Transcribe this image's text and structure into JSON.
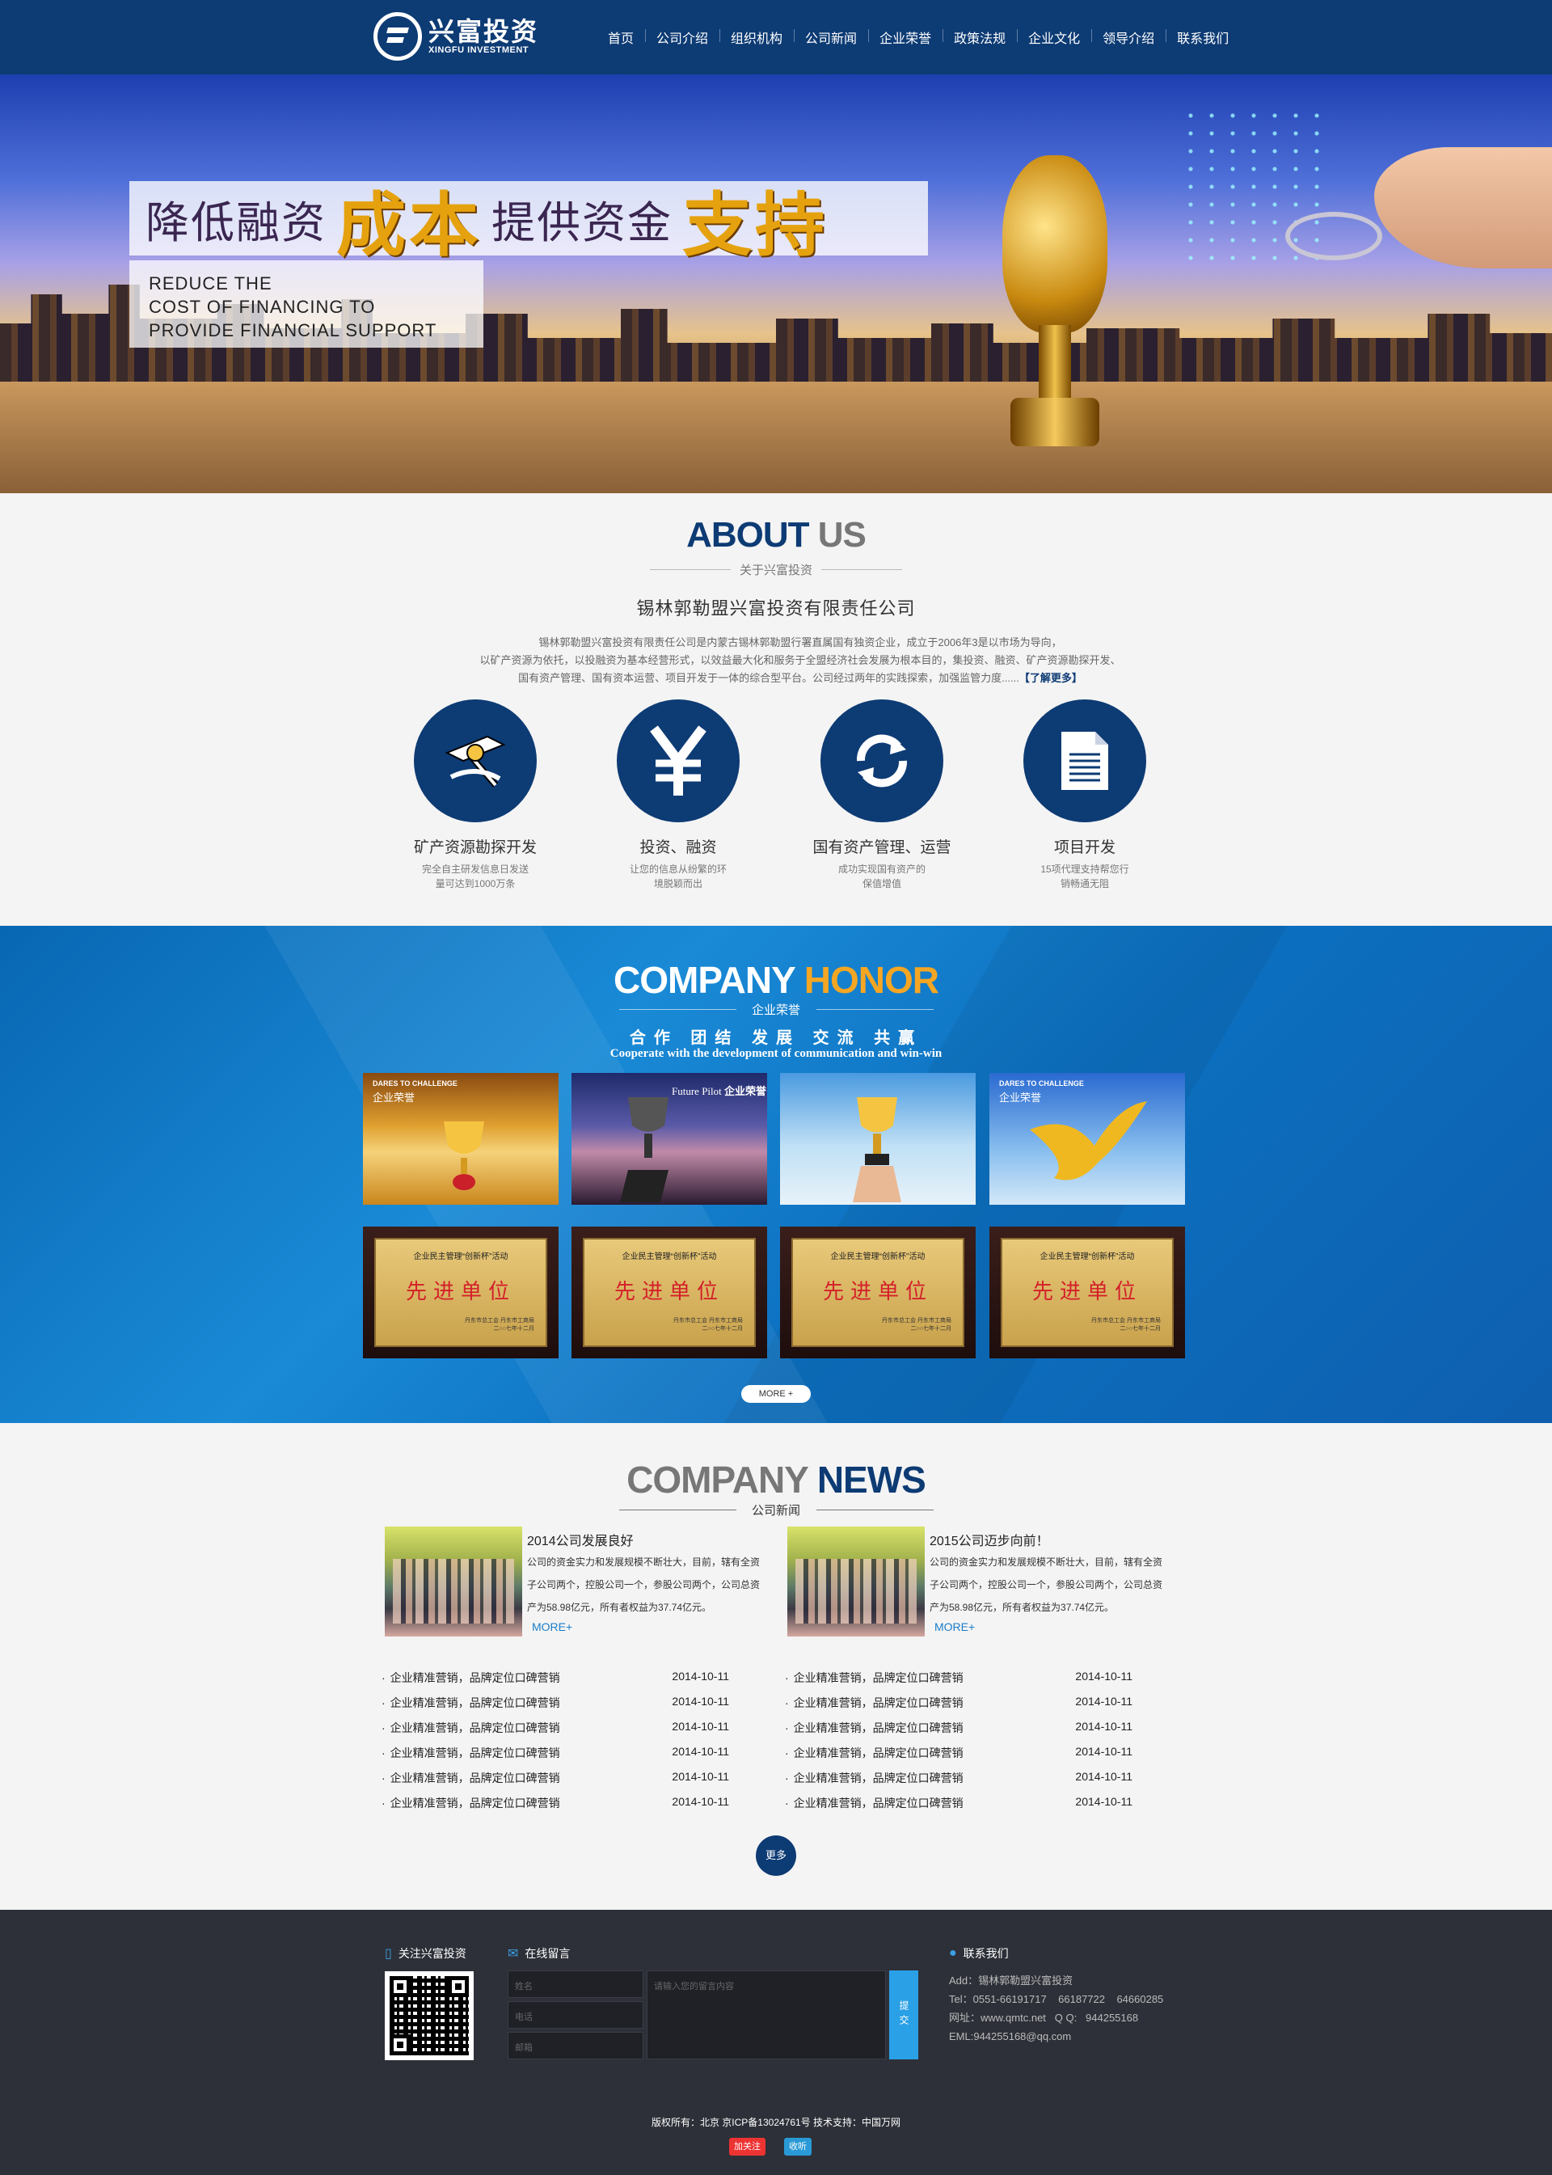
{
  "header": {
    "logo_cn": "兴富投资",
    "logo_en": "XINGFU INVESTMENT",
    "nav": [
      "首页",
      "公司介绍",
      "组织机构",
      "公司新闻",
      "企业荣誉",
      "政策法规",
      "企业文化",
      "领导介绍",
      "联系我们"
    ]
  },
  "banner": {
    "line1_part1": "降低融资",
    "line1_part2": "成本",
    "line1_part3": "提供资金",
    "line1_part4": "支持",
    "en_line1": "REDUCE THE",
    "en_line2": "COST OF FINANCING TO",
    "en_line3": "PROVIDE FINANCIAL SUPPORT"
  },
  "about": {
    "title_a": "ABOUT",
    "title_b": "US",
    "subtitle": "关于兴富投资",
    "company": "锡林郭勒盟兴富投资有限责任公司",
    "desc_line1": "锡林郭勒盟兴富投资有限责任公司是内蒙古锡林郭勒盟行署直属国有独资企业，成立于2006年3是以市场为导向，",
    "desc_line2": "以矿产资源为依托，以投融资为基本经营形式，以效益最大化和服务于全盟经济社会发展为根本目的，集投资、融资、矿产资源勘探开发、",
    "desc_line3": "国有资产管理、国有资本运营、项目开发于一体的综合型平台。公司经过两年的实践探索，加强监管力度......",
    "more": "【了解更多】",
    "services": [
      {
        "name": "矿产资源勘探开发",
        "desc1": "完全自主研发信息日发送",
        "desc2": "量可达到1000万条",
        "icon": "mining-icon"
      },
      {
        "name": "投资、融资",
        "desc1": "让您的信息从纷繁的环",
        "desc2": "境脱颖而出",
        "icon": "yen-icon"
      },
      {
        "name": "国有资产管理、运营",
        "desc1": "成功实现国有资产的",
        "desc2": "保值增值",
        "icon": "refresh-icon"
      },
      {
        "name": "项目开发",
        "desc1": "15项代理支持帮您行",
        "desc2": "销畅通无阻",
        "icon": "document-icon"
      }
    ]
  },
  "honor": {
    "title_a": "COMPANY",
    "title_b": "HONOR",
    "subtitle": "企业荣誉",
    "slogan": "合作 团结 发展 交流 共赢",
    "slogan_en": "Cooperate with the development of communication and win-win",
    "photos": [
      {
        "tag": "DARES TO CHALLENGE",
        "label": "企业荣誉"
      },
      {
        "tag": "Future Pilot",
        "label": "企业荣誉"
      },
      {
        "tag": "",
        "label": ""
      },
      {
        "tag": "DARES TO CHALLENGE",
        "label": "企业荣誉"
      }
    ],
    "plaque_top": "企业民主管理“创新杯”活动",
    "plaque_main": "先进单位",
    "plaque_org": "丹东市总工会 丹东市工商局",
    "plaque_date": "二○○七年十二月",
    "more": "MORE +"
  },
  "news": {
    "title_a": "COMPANY",
    "title_b": "NEWS",
    "subtitle": "公司新闻",
    "featured": [
      {
        "title": "2014公司发展良好",
        "text": "公司的资金实力和发展规模不断壮大，目前，辖有全资子公司两个，控股公司一个，参股公司两个，公司总资产为58.98亿元，所有者权益为37.74亿元。",
        "more": "MORE+"
      },
      {
        "title": "2015公司迈步向前！",
        "text": "公司的资金实力和发展规模不断壮大，目前，辖有全资子公司两个，控股公司一个，参股公司两个，公司总资产为58.98亿元，所有者权益为37.74亿元。",
        "more": "MORE+"
      }
    ],
    "list_left": [
      {
        "title": "企业精准营销，品牌定位口碑营销",
        "date": "2014-10-11"
      },
      {
        "title": "企业精准营销，品牌定位口碑营销",
        "date": "2014-10-11"
      },
      {
        "title": "企业精准营销，品牌定位口碑营销",
        "date": "2014-10-11"
      },
      {
        "title": "企业精准营销，品牌定位口碑营销",
        "date": "2014-10-11"
      },
      {
        "title": "企业精准营销，品牌定位口碑营销",
        "date": "2014-10-11"
      },
      {
        "title": "企业精准营销，品牌定位口碑营销",
        "date": "2014-10-11"
      }
    ],
    "list_right": [
      {
        "title": "企业精准营销，品牌定位口碑营销",
        "date": "2014-10-11"
      },
      {
        "title": "企业精准营销，品牌定位口碑营销",
        "date": "2014-10-11"
      },
      {
        "title": "企业精准营销，品牌定位口碑营销",
        "date": "2014-10-11"
      },
      {
        "title": "企业精准营销，品牌定位口碑营销",
        "date": "2014-10-11"
      },
      {
        "title": "企业精准营销，品牌定位口碑营销",
        "date": "2014-10-11"
      },
      {
        "title": "企业精准营销，品牌定位口碑营销",
        "date": "2014-10-11"
      }
    ],
    "more": "更多"
  },
  "footer": {
    "follow": "关注兴富投资",
    "message": "在线留言",
    "name_ph": "姓名",
    "phone_ph": "电话",
    "email_ph": "邮箱",
    "content_ph": "请输入您的留言内容",
    "submit": "提交",
    "contact_title": "联系我们",
    "add": "Add：锡林郭勒盟兴富投资",
    "tel": "Tel：0551-66191717    66187722    64660285",
    "web": "网址：www.qmtc.net   Q Q:   944255168",
    "eml": "EML:944255168@qq.com",
    "copyright": "版权所有：北京  京ICP备13024761号  技术支持：中国万网",
    "share1": "加关注",
    "share2": "收听"
  },
  "colors": {
    "primary": "#0d3b74",
    "accent": "#f5a623",
    "honor_bg": "#0c70c0",
    "footer_bg": "#2d3038",
    "link": "#1a7cc7"
  }
}
